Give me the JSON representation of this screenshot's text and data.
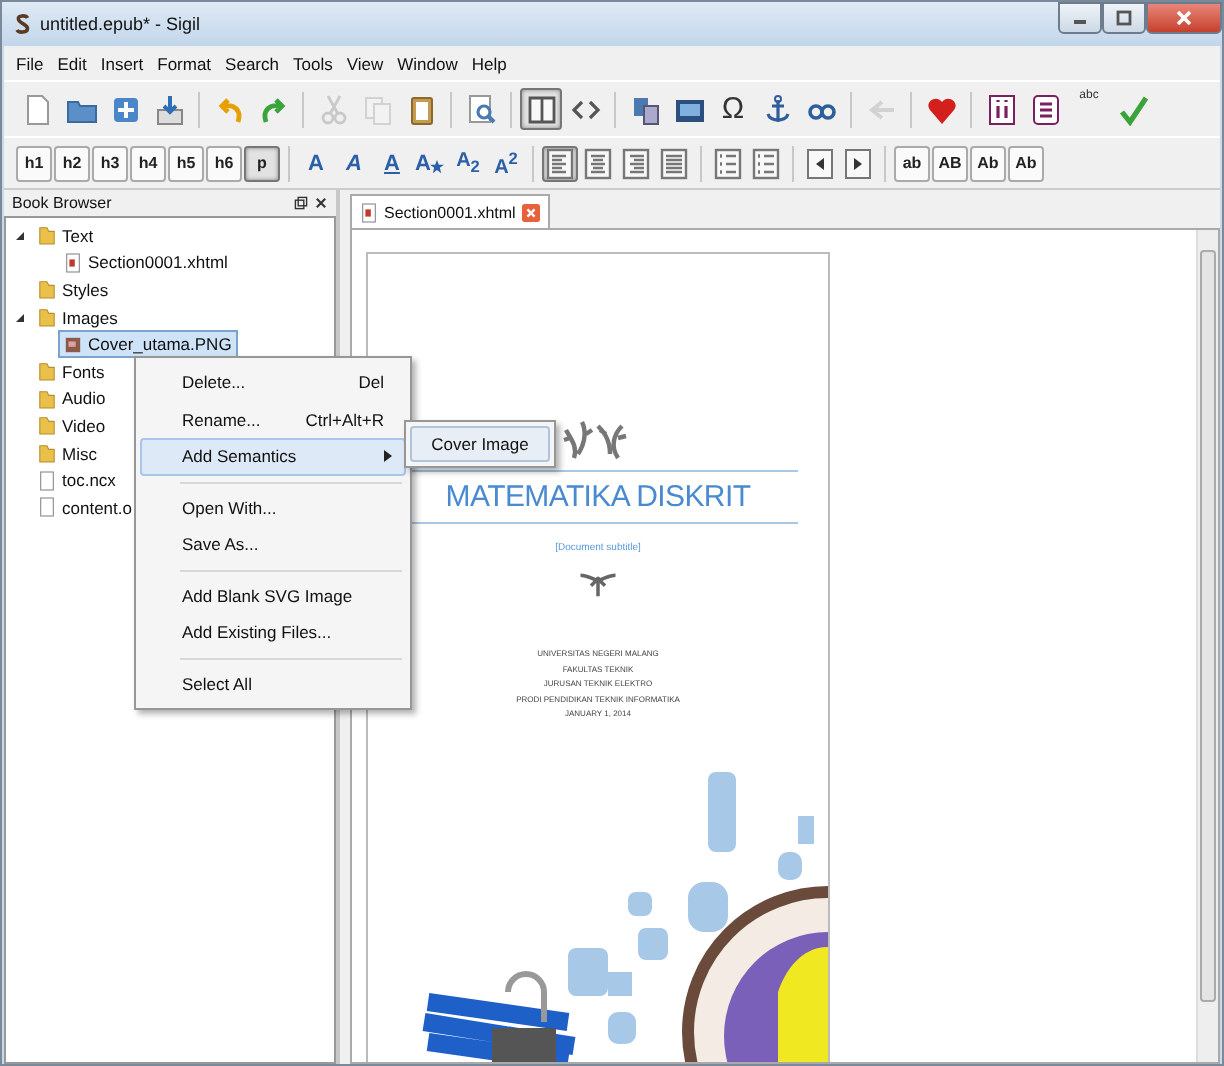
{
  "window": {
    "title": "untitled.epub* - Sigil"
  },
  "menu_bar": [
    "File",
    "Edit",
    "Insert",
    "Format",
    "Search",
    "Tools",
    "View",
    "Window",
    "Help"
  ],
  "toolbar_main": [
    [
      {
        "kind": "new",
        "pressed": false,
        "disabled": false
      },
      {
        "kind": "open",
        "pressed": false,
        "disabled": false
      },
      {
        "kind": "add",
        "pressed": false,
        "disabled": false
      },
      {
        "kind": "save",
        "pressed": false,
        "disabled": false
      }
    ],
    [
      {
        "kind": "undo",
        "pressed": false,
        "disabled": false
      },
      {
        "kind": "redo",
        "pressed": false,
        "disabled": false
      }
    ],
    [
      {
        "kind": "cut",
        "pressed": false,
        "disabled": true
      },
      {
        "kind": "copy",
        "pressed": false,
        "disabled": true
      },
      {
        "kind": "paste",
        "pressed": false,
        "disabled": false
      }
    ],
    [
      {
        "kind": "find",
        "pressed": false,
        "disabled": false
      }
    ],
    [
      {
        "kind": "book",
        "pressed": true,
        "disabled": false
      },
      {
        "kind": "code",
        "pressed": false,
        "disabled": false
      }
    ],
    [
      {
        "kind": "split",
        "pressed": false,
        "disabled": false
      },
      {
        "kind": "image",
        "pressed": false,
        "disabled": false
      },
      {
        "kind": "char",
        "label": "Ω",
        "pressed": false,
        "disabled": false
      },
      {
        "kind": "anchor",
        "pressed": false,
        "disabled": false
      },
      {
        "kind": "link",
        "pressed": false,
        "disabled": false
      }
    ],
    [
      {
        "kind": "back",
        "pressed": false,
        "disabled": true
      }
    ],
    [
      {
        "kind": "heart",
        "pressed": false,
        "disabled": false
      }
    ],
    [
      {
        "kind": "info",
        "pressed": false,
        "disabled": false
      },
      {
        "kind": "toc",
        "pressed": false,
        "disabled": false
      },
      {
        "kind": "spell",
        "label": "abc",
        "pressed": false,
        "disabled": false
      },
      {
        "kind": "check",
        "pressed": false,
        "disabled": false
      }
    ]
  ],
  "toolbar_format": [
    [
      {
        "kind": "text",
        "label": "h1",
        "pressed": false
      },
      {
        "kind": "text",
        "label": "h2",
        "pressed": false
      },
      {
        "kind": "text",
        "label": "h3",
        "pressed": false
      },
      {
        "kind": "text",
        "label": "h4",
        "pressed": false
      },
      {
        "kind": "text",
        "label": "h5",
        "pressed": false
      },
      {
        "kind": "text",
        "label": "h6",
        "pressed": false
      },
      {
        "kind": "text",
        "label": "p",
        "pressed": true
      }
    ],
    [
      {
        "kind": "bold",
        "label": "A",
        "pressed": false
      },
      {
        "kind": "italic",
        "label": "A",
        "pressed": false
      },
      {
        "kind": "underline",
        "label": "A",
        "pressed": false
      },
      {
        "kind": "strike",
        "label": "A",
        "pressed": false
      },
      {
        "kind": "sub",
        "label": "A$_{2}$",
        "pressed": false
      },
      {
        "kind": "sup",
        "label": "A$^{2}$",
        "pressed": false
      }
    ],
    [
      {
        "kind": "align-left",
        "pressed": true
      },
      {
        "kind": "align-center",
        "pressed": false
      },
      {
        "kind": "align-right",
        "pressed": false
      },
      {
        "kind": "align-justify",
        "pressed": false
      }
    ],
    [
      {
        "kind": "bullets",
        "pressed": false
      },
      {
        "kind": "numbers",
        "pressed": false
      }
    ],
    [
      {
        "kind": "outdent",
        "pressed": false
      },
      {
        "kind": "indent",
        "pressed": false
      }
    ],
    [
      {
        "kind": "text",
        "label": "ab",
        "pressed": false
      },
      {
        "kind": "text",
        "label": "AB",
        "pressed": false
      },
      {
        "kind": "text",
        "label": "Ab",
        "pressed": false
      },
      {
        "kind": "text",
        "label": "Ab",
        "pressed": false
      }
    ]
  ],
  "book_browser": {
    "title": "Book Browser",
    "items": [
      {
        "label": "Text",
        "kind": "folder",
        "selected": false,
        "expanded": true,
        "children": [
          {
            "label": "Section0001.xhtml",
            "kind": "xhtml",
            "selected": false
          }
        ]
      },
      {
        "label": "Styles",
        "kind": "folder",
        "selected": false
      },
      {
        "label": "Images",
        "kind": "folder",
        "selected": false,
        "expanded": true,
        "children": [
          {
            "label": "Cover_utama.PNG",
            "kind": "image",
            "selected": true
          }
        ]
      },
      {
        "label": "Fonts",
        "kind": "folder",
        "selected": false
      },
      {
        "label": "Audio",
        "kind": "folder",
        "selected": false
      },
      {
        "label": "Video",
        "kind": "folder",
        "selected": false
      },
      {
        "label": "Misc",
        "kind": "folder",
        "selected": false
      },
      {
        "label": "toc.ncx",
        "kind": "file",
        "selected": false
      },
      {
        "label": "content.o",
        "kind": "file",
        "selected": false
      }
    ]
  },
  "tabs": [
    {
      "label": "Section0001.xhtml",
      "selected": true
    }
  ],
  "document": {
    "title": "MATEMATIKA DISKRIT",
    "subtitle": "[Document subtitle]",
    "info_lines": [
      "UNIVERSITAS NEGERI MALANG",
      "FAKULTAS TEKNIK",
      "JURUSAN TEKNIK ELEKTRO",
      "PRODI PENDIDIKAN TEKNIK INFORMATIKA",
      "JANUARY 1, 2014"
    ]
  },
  "context_menu": {
    "sections": [
      {
        "items": [
          {
            "label": "Delete...",
            "shortcut": "Del",
            "highlighted": false,
            "submenu": false
          },
          {
            "label": "Rename...",
            "shortcut": "Ctrl+Alt+R",
            "highlighted": false,
            "submenu": false
          },
          {
            "label": "Add Semantics",
            "highlighted": true,
            "submenu": true
          }
        ]
      },
      {
        "items": [
          {
            "label": "Open With...",
            "highlighted": false,
            "submenu": false
          },
          {
            "label": "Save As...",
            "highlighted": false,
            "submenu": false
          }
        ]
      },
      {
        "items": [
          {
            "label": "Add Blank SVG Image",
            "highlighted": false,
            "submenu": false
          },
          {
            "label": "Add Existing Files...",
            "highlighted": false,
            "submenu": false
          }
        ]
      },
      {
        "items": [
          {
            "label": "Select All",
            "highlighted": false,
            "submenu": false
          }
        ]
      }
    ]
  },
  "submenu": {
    "items": [
      {
        "label": "Cover Image",
        "highlighted": true
      }
    ]
  }
}
